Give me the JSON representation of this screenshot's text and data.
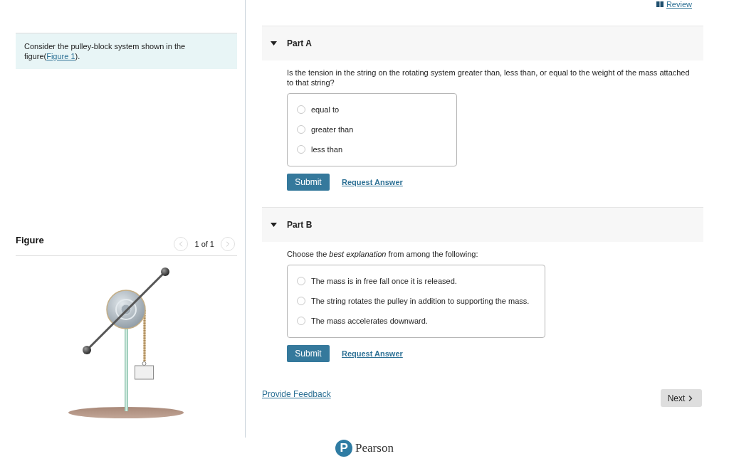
{
  "review_link": {
    "label": "Review"
  },
  "intro": {
    "text": "Consider the pulley-block system shown in the figure(",
    "link": "Figure 1",
    "text_after": ")."
  },
  "figure": {
    "title": "Figure",
    "pager": "1 of 1",
    "prev_disabled": true,
    "next_disabled": true
  },
  "parts": [
    {
      "title": "Part A",
      "expanded": true,
      "question": "Is the tension in the string on the rotating system greater than, less than, or equal to the weight of the mass attached to that string?",
      "options": [
        {
          "label": "equal to",
          "selected": false
        },
        {
          "label": "greater than",
          "selected": false
        },
        {
          "label": "less than",
          "selected": false
        }
      ],
      "submit": "Submit",
      "request": "Request Answer"
    },
    {
      "title": "Part B",
      "expanded": true,
      "question": "Choose the *best explanation* from among the following:",
      "options": [
        {
          "label": "The mass is in free fall once it is released.",
          "selected": false
        },
        {
          "label": "The string rotates the pulley in addition to supporting the mass.",
          "selected": false
        },
        {
          "label": "The mass accelerates downward.",
          "selected": false
        }
      ],
      "submit": "Submit",
      "request": "Request Answer"
    }
  ],
  "feedback_link": "Provide Feedback",
  "next_button": "Next",
  "logo": {
    "mark": "P",
    "name": "Pearson"
  }
}
